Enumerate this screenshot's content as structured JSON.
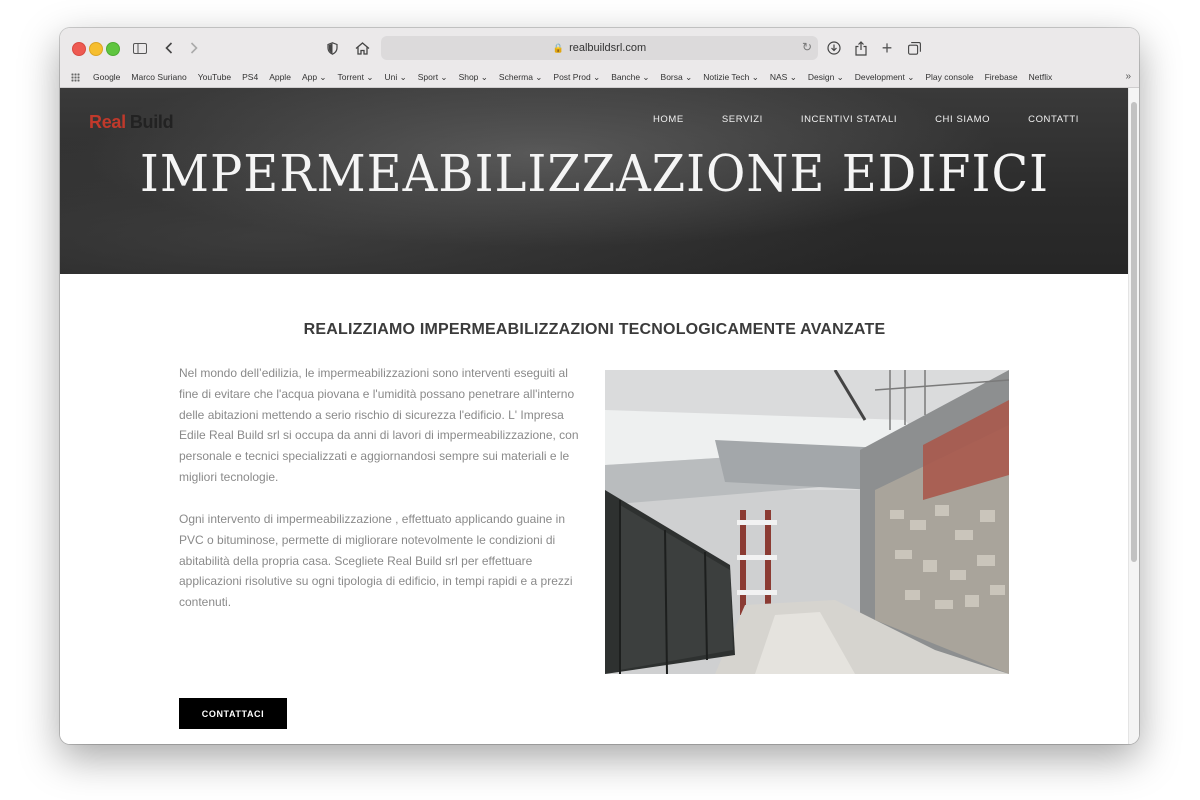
{
  "browser": {
    "url": "realbuildsrl.com",
    "bookmarks": [
      "Google",
      "Marco Suriano",
      "YouTube",
      "PS4",
      "Apple",
      "App ⌄",
      "Torrent ⌄",
      "Uni ⌄",
      "Sport ⌄",
      "Shop ⌄",
      "Scherma ⌄",
      "Post Prod ⌄",
      "Banche ⌄",
      "Borsa ⌄",
      "Notizie Tech ⌄",
      "NAS ⌄",
      "Design ⌄",
      "Development ⌄",
      "Play console",
      "Firebase",
      "Netflix"
    ],
    "icons": [
      "sidebar-icon",
      "back-icon",
      "forward-icon",
      "shield-icon",
      "home-icon",
      "reload-icon",
      "download-icon",
      "share-icon",
      "new-tab-icon",
      "tabs-overview-icon"
    ]
  },
  "site": {
    "logo_red": "Real",
    "logo_dark": "Build",
    "nav": [
      "HOME",
      "SERVIZI",
      "INCENTIVI STATALI",
      "CHI SIAMO",
      "CONTATTI"
    ],
    "hero_title": "IMPERMEABILIZZAZIONE EDIFICI",
    "section_title": "REALIZZIAMO IMPERMEABILIZZAZIONI TECNOLOGICAMENTE AVANZATE",
    "paragraph1": "Nel mondo dell’edilizia, le impermeabilizzazioni sono interventi eseguiti al fine di evitare che l'acqua piovana e l'umidità possano penetrare all'interno delle abitazioni mettendo a serio rischio di sicurezza l'edificio. L' Impresa Edile Real Build srl si occupa da anni di lavori di impermeabilizzazione, con personale e tecnici specializzati e aggiornandosi sempre sui materiali e le migliori tecnologie.",
    "paragraph2": "Ogni intervento di impermeabilizzazione , effettuato applicando guaine in PVC o bituminose, permette di migliorare notevolmente le condizioni di abitabilità della propria casa. Scegliete Real Build srl per effettuare applicazioni risolutive su ogni tipologia di edificio, in tempi rapidi e a prezzi contenuti.",
    "cta_label": "CONTATTACI"
  },
  "colors": {
    "brand_red": "#c0392b",
    "hero_bg": "#2b2b2b",
    "text_gray": "#8a8a8a",
    "cta_bg": "#000000"
  }
}
